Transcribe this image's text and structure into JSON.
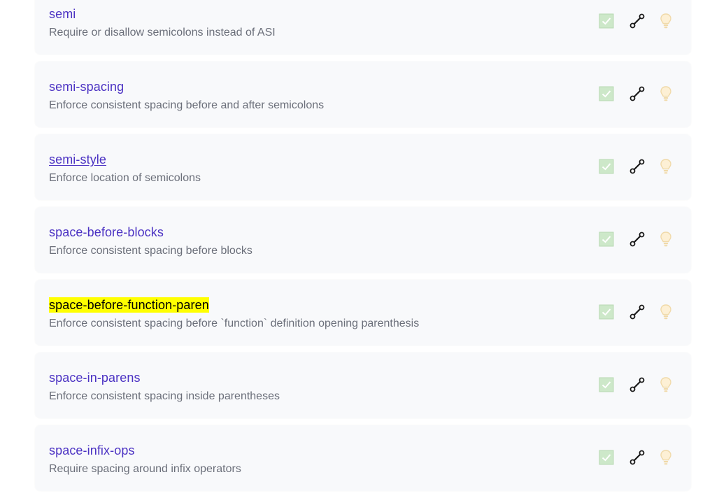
{
  "colors": {
    "link": "#4b32c3",
    "description": "#6b6f7a",
    "highlight": "#ffff00",
    "card_background": "#f8f9fb",
    "recommended_check": "#cde8c9",
    "fixable_wrench": "#1a1a1a",
    "suggestion_bulb": "#f5deb3"
  },
  "icons": {
    "recommended": "checkbox-check-icon",
    "fixable": "wrench-icon",
    "suggestions": "lightbulb-icon"
  },
  "rules": [
    {
      "name": "semi",
      "description": "Require or disallow semicolons instead of ASI"
    },
    {
      "name": "semi-spacing",
      "description": "Enforce consistent spacing before and after semicolons"
    },
    {
      "name": "semi-style",
      "description": "Enforce location of semicolons"
    },
    {
      "name": "space-before-blocks",
      "description": "Enforce consistent spacing before blocks"
    },
    {
      "name": "space-before-function-paren",
      "description": "Enforce consistent spacing before `function` definition opening parenthesis"
    },
    {
      "name": "space-in-parens",
      "description": "Enforce consistent spacing inside parentheses"
    },
    {
      "name": "space-infix-ops",
      "description": "Require spacing around infix operators"
    }
  ]
}
